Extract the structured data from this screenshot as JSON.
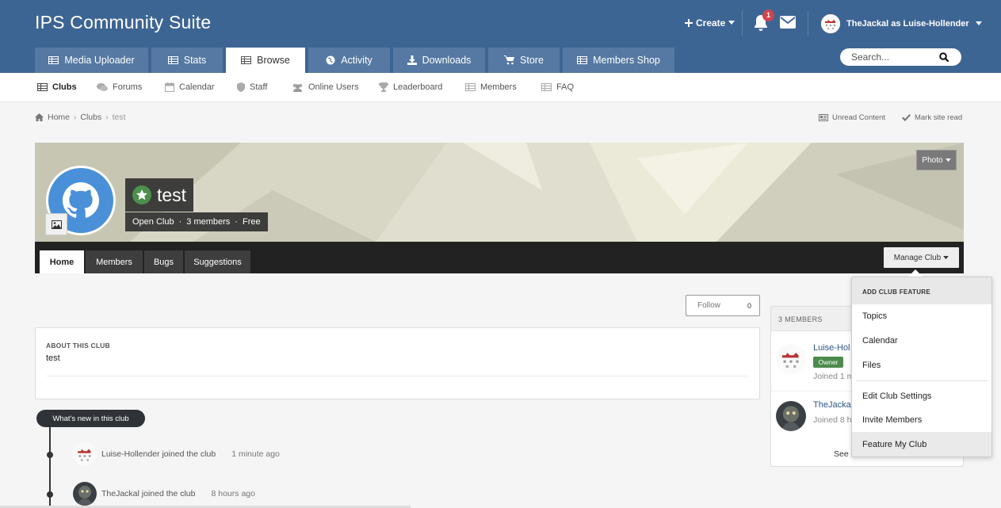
{
  "header": {
    "site_title": "IPS Community Suite",
    "create_label": "Create",
    "notification_count": "1",
    "user_label": "TheJackal as Luise-Hollender"
  },
  "main_tabs": [
    {
      "label": "Media Uploader",
      "icon": "table-icon"
    },
    {
      "label": "Stats",
      "icon": "table-icon"
    },
    {
      "label": "Browse",
      "icon": "table-icon",
      "active": true
    },
    {
      "label": "Activity",
      "icon": "globe-icon"
    },
    {
      "label": "Downloads",
      "icon": "download-icon"
    },
    {
      "label": "Store",
      "icon": "cart-icon"
    },
    {
      "label": "Members Shop",
      "icon": "table-icon"
    }
  ],
  "search": {
    "placeholder": "Search..."
  },
  "sub_nav": [
    {
      "label": "Clubs",
      "icon": "table-icon",
      "active": true
    },
    {
      "label": "Forums",
      "icon": "chat-icon"
    },
    {
      "label": "Calendar",
      "icon": "calendar-icon"
    },
    {
      "label": "Staff",
      "icon": "shield-icon"
    },
    {
      "label": "Online Users",
      "icon": "users-icon"
    },
    {
      "label": "Leaderboard",
      "icon": "trophy-icon"
    },
    {
      "label": "Members",
      "icon": "table-icon"
    },
    {
      "label": "FAQ",
      "icon": "table-icon"
    }
  ],
  "breadcrumb": {
    "home": "Home",
    "section": "Clubs",
    "current": "test"
  },
  "page_actions": {
    "unread": "Unread Content",
    "mark_read": "Mark site read"
  },
  "club": {
    "name": "test",
    "type": "Open Club",
    "members": "3 members",
    "price": "Free",
    "photo_label": "Photo",
    "tabs": [
      "Home",
      "Members",
      "Bugs",
      "Suggestions"
    ],
    "manage_label": "Manage Club",
    "follow_label": "Follow",
    "follow_count": "0",
    "about_label": "ABOUT THIS CLUB",
    "about_text": "test"
  },
  "timeline": {
    "header": "What's new in this club",
    "events": [
      {
        "text": "Luise-Hollender joined the club",
        "time": "1 minute ago"
      },
      {
        "text": "TheJackal joined the club",
        "time": "8 hours ago"
      }
    ]
  },
  "members_card": {
    "title": "3 MEMBERS",
    "members": [
      {
        "name": "Luise-Hol",
        "badge": "Owner",
        "joined": "Joined 1 m"
      },
      {
        "name": "TheJackal",
        "joined": "Joined 8 h"
      }
    ],
    "see_all": "See a"
  },
  "dropdown": {
    "title": "ADD CLUB FEATURE",
    "features": [
      "Topics",
      "Calendar",
      "Files"
    ],
    "actions": [
      "Edit Club Settings",
      "Invite Members",
      "Feature My Club"
    ]
  },
  "colors": {
    "header_bg": "#3d6594",
    "tab_bg": "#5579a2",
    "owner_badge": "#4b8b4b",
    "notification_badge": "#d0434e"
  }
}
